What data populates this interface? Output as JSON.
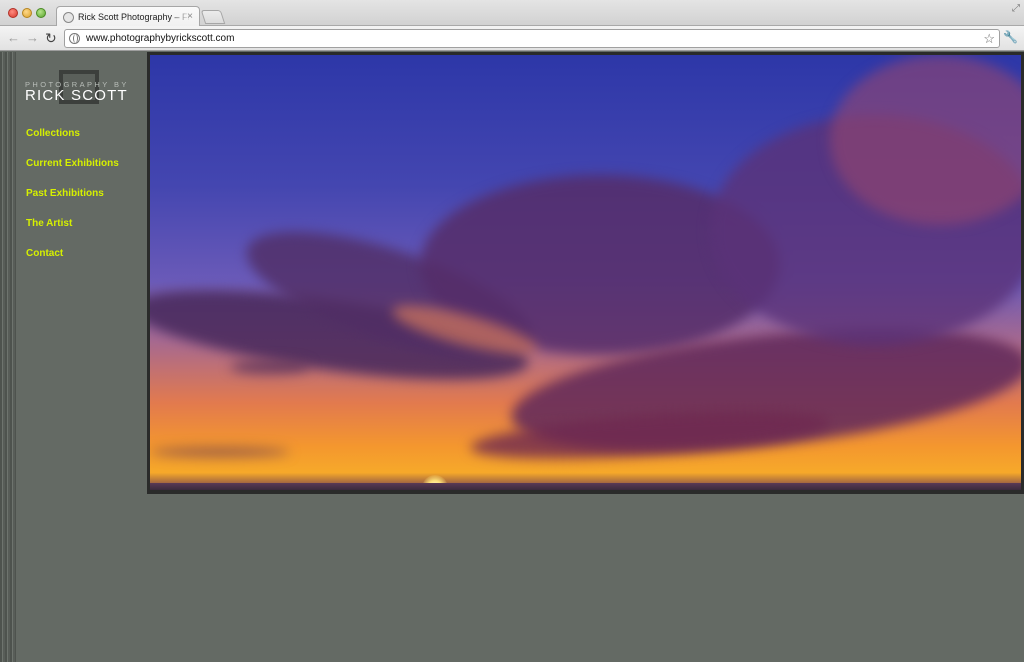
{
  "browser": {
    "tab_title": "Rick Scott Photography – Fi",
    "tab_close": "×",
    "url": "www.photographybyrickscott.com"
  },
  "site": {
    "logo_top": "PHOTOGRAPHY BY",
    "logo_main": "RICK SCOTT",
    "nav": [
      "Collections",
      "Current Exhibitions",
      "Past Exhibitions",
      "The Artist",
      "Contact"
    ],
    "nav_color": "#d6f000",
    "background_color": "#646a64"
  },
  "hero_image": {
    "subject": "sunset-sky-with-clouds"
  }
}
